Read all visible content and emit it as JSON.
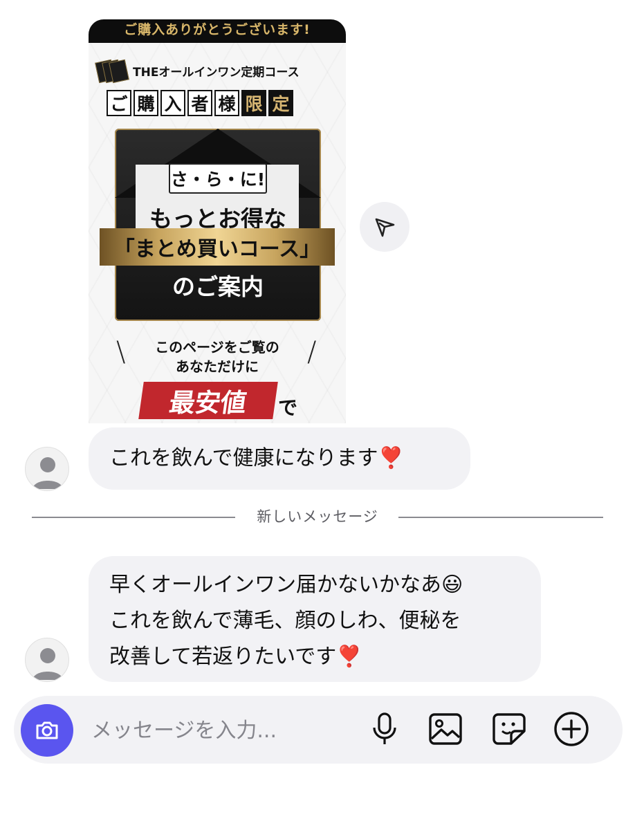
{
  "promo": {
    "top_banner": "ご購入ありがとうございます!",
    "brand": "THEオールインワン定期コース",
    "limited_chars": [
      "ご",
      "購",
      "入",
      "者",
      "様",
      "限",
      "定"
    ],
    "sara": "さ・ら・に!",
    "motto": "もっとお得な",
    "course": "「まとめ買いコース」",
    "annai": "のご案内",
    "exclusive_line1": "このページをご覧の",
    "exclusive_line2": "あなただけに",
    "cheapest": "最安値",
    "de": "で"
  },
  "messages": [
    {
      "text": "これを飲んで健康になります❣️"
    },
    {
      "lines": [
        "早くオールインワン届かないかなあ😃",
        "これを飲んで薄毛、顔のしわ、便秘を",
        "改善して若返りたいです❣️"
      ]
    }
  ],
  "divider_label": "新しいメッセージ",
  "input": {
    "placeholder": "メッセージを入力..."
  },
  "icons": {
    "share": "send-icon",
    "camera": "camera-icon",
    "mic": "microphone-icon",
    "image": "image-icon",
    "sticker": "sticker-icon",
    "add": "plus-circle-icon"
  },
  "colors": {
    "camera_button": "#5a55ef",
    "bubble": "#f2f2f5",
    "cheapest_red": "#c1272d",
    "gold": "#d6b572"
  }
}
